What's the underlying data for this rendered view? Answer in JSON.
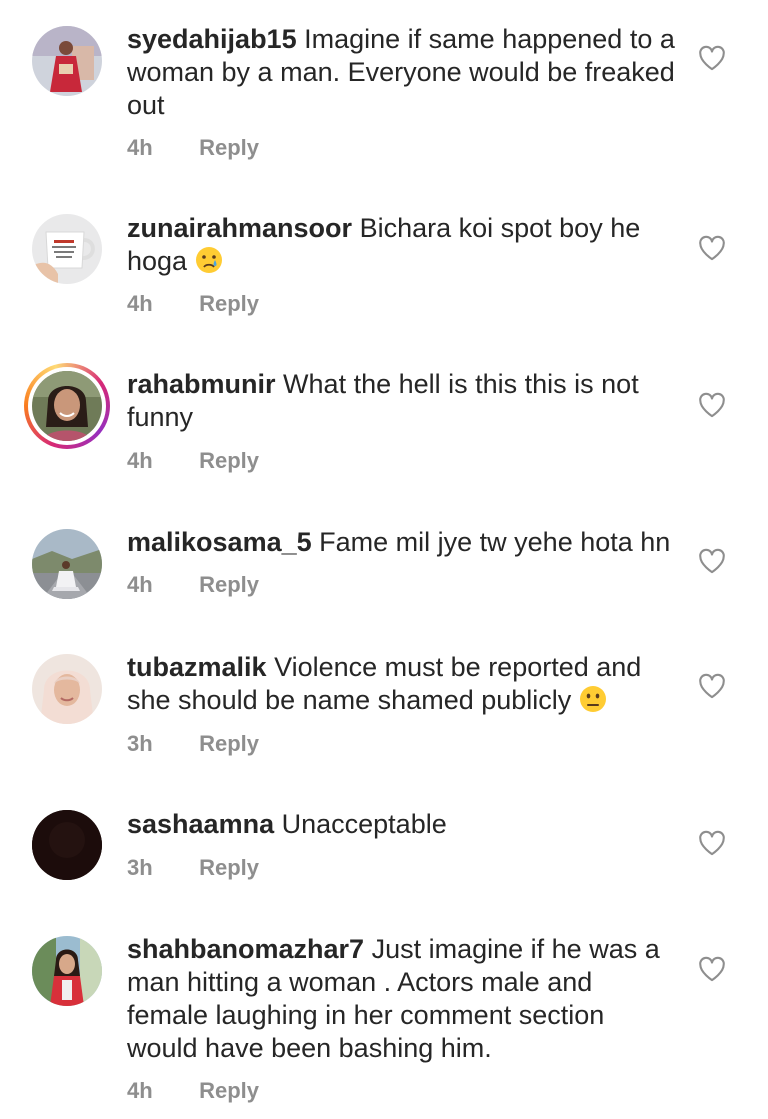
{
  "comments": [
    {
      "username": "syedahijab15",
      "text": "Imagine if same happened to a woman by a man. Everyone would be freaked out",
      "time": "4h",
      "reply_label": "Reply",
      "avatar_icon": "avatar-photo-red-dress"
    },
    {
      "username": "zunairahmansoor",
      "text": "Bichara koi spot boy he hoga",
      "emoji": "crying-face",
      "time": "4h",
      "reply_label": "Reply",
      "avatar_icon": "avatar-photo-mug"
    },
    {
      "username": "rahabmunir",
      "text": "What the hell is this this is not funny",
      "time": "4h",
      "reply_label": "Reply",
      "avatar_icon": "avatar-photo-woman",
      "story_ring": true
    },
    {
      "username": "malikosama_5",
      "text": "Fame mil jye tw yehe hota hn",
      "time": "4h",
      "reply_label": "Reply",
      "avatar_icon": "avatar-photo-road"
    },
    {
      "username": "tubazmalik",
      "text": "Violence must be reported and she should be name shamed publicly",
      "emoji": "neutral-face",
      "time": "3h",
      "reply_label": "Reply",
      "avatar_icon": "avatar-photo-hijab"
    },
    {
      "username": "sashaamna",
      "text": "Unacceptable",
      "time": "3h",
      "reply_label": "Reply",
      "avatar_icon": "avatar-dark"
    },
    {
      "username": "shahbanomazhar7",
      "text": "Just imagine if he was a man hitting a woman .  Actors male and female laughing in her comment section would have been bashing him.",
      "time": "4h",
      "reply_label": "Reply",
      "avatar_icon": "avatar-photo-red-outfit"
    }
  ],
  "icons": {
    "like": "heart-outline-icon"
  },
  "colors": {
    "text": "#262626",
    "meta": "#8e8e8e",
    "background": "#ffffff"
  }
}
